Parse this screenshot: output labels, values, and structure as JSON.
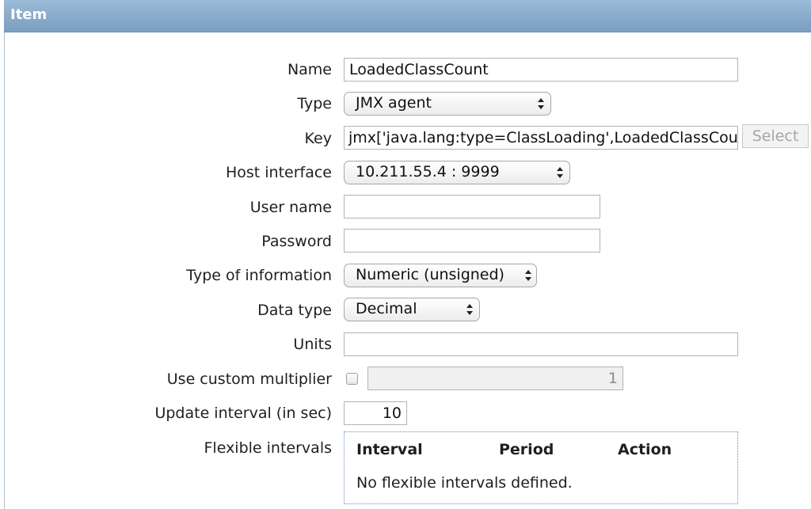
{
  "header": {
    "title": "Item"
  },
  "form": {
    "name": {
      "label": "Name",
      "value": "LoadedClassCount"
    },
    "type": {
      "label": "Type",
      "value": "JMX agent"
    },
    "key": {
      "label": "Key",
      "value": "jmx['java.lang:type=ClassLoading',LoadedClassCount]",
      "button_label": "Select"
    },
    "host_interface": {
      "label": "Host interface",
      "value": "10.211.55.4 : 9999"
    },
    "user_name": {
      "label": "User name",
      "value": ""
    },
    "password": {
      "label": "Password",
      "value": ""
    },
    "type_of_information": {
      "label": "Type of information",
      "value": "Numeric (unsigned)"
    },
    "data_type": {
      "label": "Data type",
      "value": "Decimal"
    },
    "units": {
      "label": "Units",
      "value": ""
    },
    "custom_multiplier": {
      "label": "Use custom multiplier",
      "checked": false,
      "value": "1"
    },
    "update_interval": {
      "label": "Update interval (in sec)",
      "value": "10"
    },
    "flexible_intervals": {
      "label": "Flexible intervals",
      "columns": [
        "Interval",
        "Period",
        "Action"
      ],
      "empty_text": "No flexible intervals defined."
    }
  },
  "colors": {
    "header_bg": "#7a9fc1",
    "header_text": "#ffffff",
    "border": "#b3b3b3"
  },
  "icons": {
    "select_arrows": "up-down-arrows-icon"
  }
}
